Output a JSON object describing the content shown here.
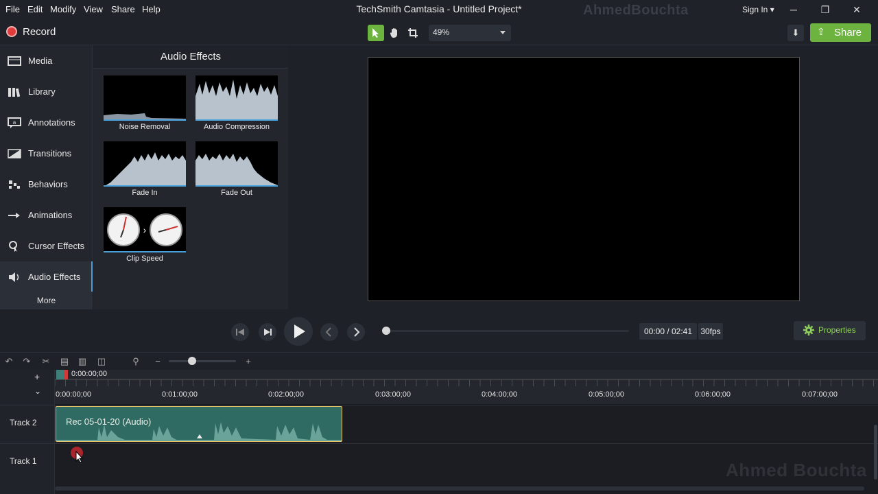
{
  "menu": [
    "File",
    "Edit",
    "Modify",
    "View",
    "Share",
    "Help"
  ],
  "title": "TechSmith Camtasia - Untitled Project*",
  "watermark_top": "AhmedBouchta",
  "watermark_bottom": "Ahmed Bouchta",
  "sign_in": "Sign In",
  "toolbar": {
    "record": "Record",
    "zoom": "49%",
    "share": "Share"
  },
  "nav": [
    {
      "label": "Media",
      "icon": "media-icon"
    },
    {
      "label": "Library",
      "icon": "library-icon"
    },
    {
      "label": "Annotations",
      "icon": "annotations-icon"
    },
    {
      "label": "Transitions",
      "icon": "transitions-icon"
    },
    {
      "label": "Behaviors",
      "icon": "behaviors-icon"
    },
    {
      "label": "Animations",
      "icon": "animations-icon"
    },
    {
      "label": "Cursor Effects",
      "icon": "cursor-effects-icon"
    },
    {
      "label": "Audio Effects",
      "icon": "audio-effects-icon"
    }
  ],
  "nav_more": "More",
  "panel_title": "Audio Effects",
  "effects": [
    "Noise Removal",
    "Audio Compression",
    "Fade In",
    "Fade Out",
    "Clip Speed"
  ],
  "playback": {
    "time": "00:00 / 02:41",
    "fps": "30fps",
    "properties": "Properties"
  },
  "timeline": {
    "playhead": "0:00:00;00",
    "ticks": [
      "0:00:00;00",
      "0:01:00;00",
      "0:02:00;00",
      "0:03:00;00",
      "0:04:00;00",
      "0:05:00;00",
      "0:06:00;00",
      "0:07:00;00"
    ],
    "tracks": [
      "Track 2",
      "Track 1"
    ],
    "clip": "Rec 05-01-20 (Audio)"
  },
  "colors": {
    "accent_green": "#6cb33f",
    "record_red": "#e23b3b",
    "selection_blue": "#4a9fd8",
    "clip_border": "#e7c66a"
  }
}
